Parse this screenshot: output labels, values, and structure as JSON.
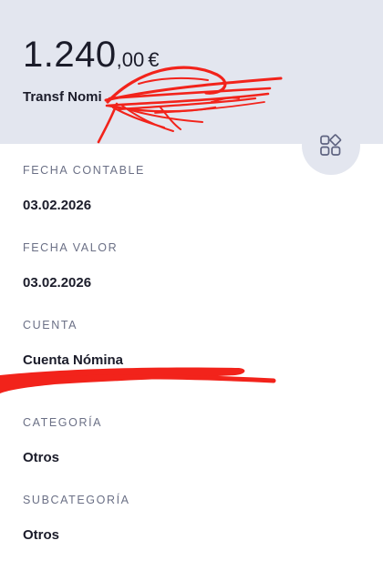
{
  "header": {
    "amount_int": "1.240",
    "amount_dec": ",00",
    "currency": "€",
    "concept": "Transf Nomi"
  },
  "category_button": {
    "icon": "category-grid-icon"
  },
  "fields": {
    "fecha_contable_label": "FECHA CONTABLE",
    "fecha_contable_value": "03.02.2026",
    "fecha_valor_label": "FECHA VALOR",
    "fecha_valor_value": "03.02.2026",
    "cuenta_label": "CUENTA",
    "cuenta_value": "Cuenta Nómina",
    "categoria_label": "CATEGORÍA",
    "categoria_value": "Otros",
    "subcategoria_label": "SUBCATEGORÍA",
    "subcategoria_value": "Otros"
  },
  "colors": {
    "header_bg": "#e3e6ef",
    "text": "#1b1c2a",
    "label": "#6b7086",
    "redaction": "#f2231b"
  }
}
